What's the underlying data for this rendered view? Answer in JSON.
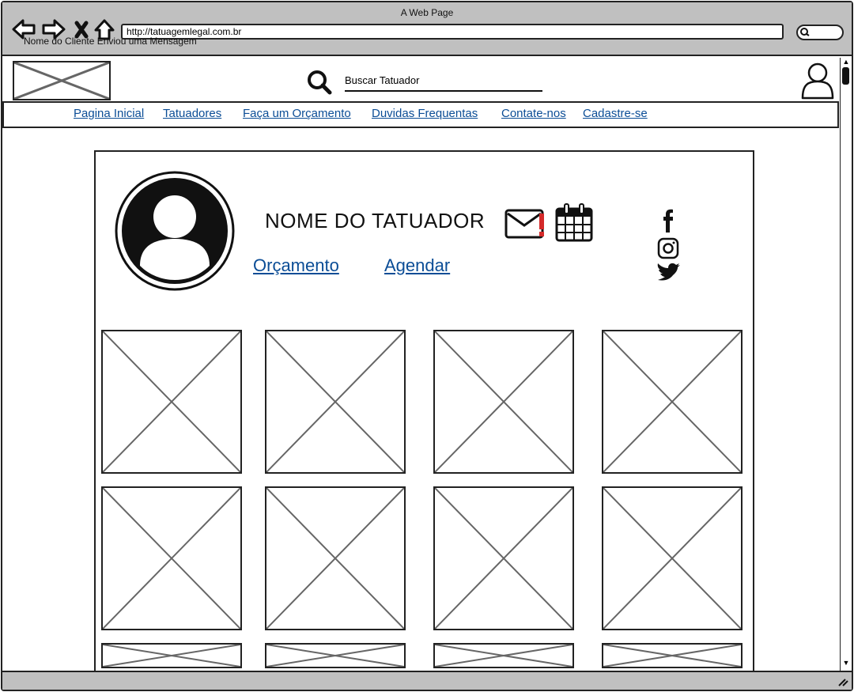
{
  "browser": {
    "title": "A Web Page",
    "url": "http://tatuagemlegal.com.br",
    "status_text": "Nome do Cliente Enviou uma Mensagem"
  },
  "header": {
    "search_placeholder": "Buscar Tatuador",
    "icons": [
      "logo-placeholder",
      "search-icon",
      "user-icon"
    ]
  },
  "nav": {
    "items": [
      {
        "label": "Pagina Inicial"
      },
      {
        "label": "Tatuadores"
      },
      {
        "label": "Faça um Orçamento"
      },
      {
        "label": "Duvidas Frequentas"
      },
      {
        "label": "Contate-nos"
      },
      {
        "label": "Cadastre-se"
      }
    ]
  },
  "profile": {
    "name": "NOME DO TATUADOR",
    "quote_link": "Orçamento",
    "schedule_link": "Agendar",
    "icons": [
      "avatar-icon",
      "mail-alert-icon",
      "calendar-icon",
      "facebook-icon",
      "instagram-icon",
      "twitter-icon"
    ],
    "alert_color": "#d42a2a"
  },
  "gallery": {
    "rows": 3,
    "columns": 4
  },
  "colors": {
    "link": "#0b4d96",
    "chrome": "#c0c0c0"
  }
}
